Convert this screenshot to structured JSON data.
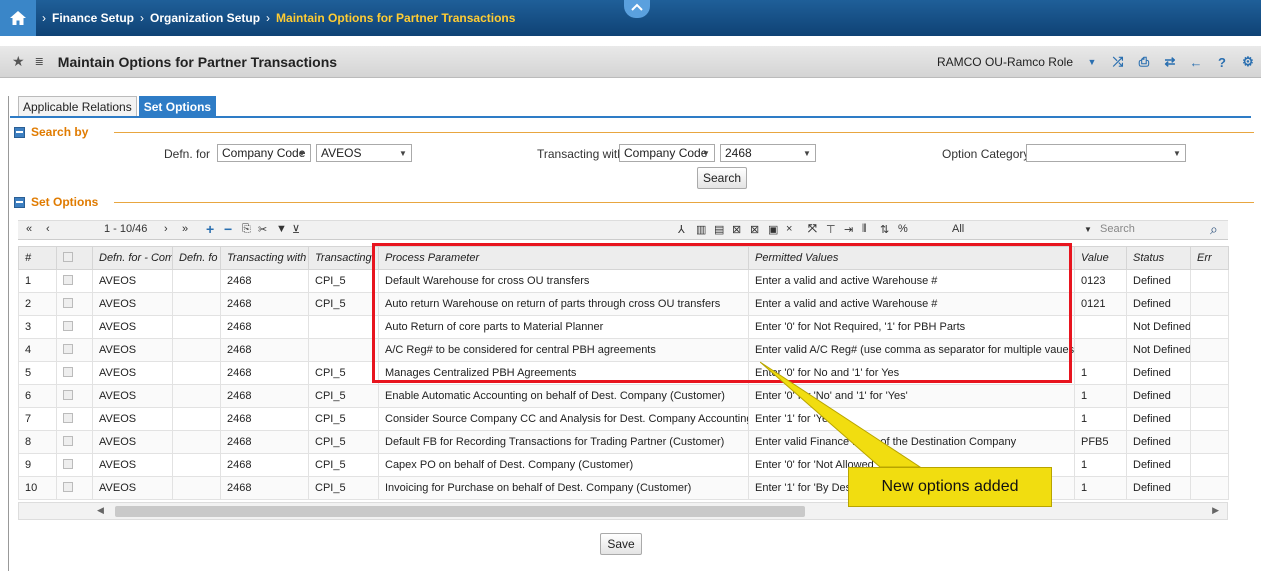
{
  "breadcrumb": {
    "items": [
      "Finance Setup",
      "Organization Setup"
    ],
    "current": "Maintain Options for Partner Transactions"
  },
  "title": "Maintain Options for Partner Transactions",
  "role": "RAMCO OU-Ramco Role",
  "tabs": [
    "Applicable Relations",
    "Set Options"
  ],
  "search_section": {
    "label": "Search by",
    "defn_for_label": "Defn. for",
    "defn_for_value": "Company Code",
    "company_value": "AVEOS",
    "transacting_label": "Transacting with",
    "transacting_value": "Company Code",
    "transacting_company": "2468",
    "option_category_label": "Option Category",
    "option_category_value": "",
    "search_button": "Search"
  },
  "options_section": {
    "label": "Set Options",
    "pager": "1 - 10/46",
    "filter_value": "All",
    "search_placeholder": "Search"
  },
  "table": {
    "columns": [
      "#",
      "",
      "Defn. for - Com",
      "Defn. fo",
      "Transacting with",
      "Transacting",
      "Process Parameter",
      "Permitted Values",
      "Value",
      "Status",
      "Err"
    ],
    "rows": [
      [
        "1",
        "",
        "AVEOS",
        "",
        "2468",
        "CPI_5",
        "Default Warehouse for cross OU transfers",
        "Enter a valid and active Warehouse #",
        "0123",
        "Defined",
        ""
      ],
      [
        "2",
        "",
        "AVEOS",
        "",
        "2468",
        "CPI_5",
        "Auto return Warehouse on return of parts through cross OU transfers",
        "Enter a valid and active Warehouse #",
        "0121",
        "Defined",
        ""
      ],
      [
        "3",
        "",
        "AVEOS",
        "",
        "2468",
        "",
        "Auto Return of core parts to Material Planner",
        "Enter '0' for Not Required, '1' for PBH Parts",
        "",
        "Not Defined",
        ""
      ],
      [
        "4",
        "",
        "AVEOS",
        "",
        "2468",
        "",
        "A/C Reg# to be considered for central PBH agreements",
        "Enter valid A/C Reg# (use comma as separator for multiple vaues)",
        "",
        "Not Defined",
        ""
      ],
      [
        "5",
        "",
        "AVEOS",
        "",
        "2468",
        "CPI_5",
        "Manages Centralized PBH Agreements",
        "Enter '0' for No and '1' for Yes",
        "1",
        "Defined",
        ""
      ],
      [
        "6",
        "",
        "AVEOS",
        "",
        "2468",
        "CPI_5",
        "Enable Automatic Accounting on behalf of Dest. Company (Customer)",
        "Enter '0' for 'No' and '1' for 'Yes'",
        "1",
        "Defined",
        ""
      ],
      [
        "7",
        "",
        "AVEOS",
        "",
        "2468",
        "CPI_5",
        "Consider Source Company CC and Analysis for Dest. Company Accounting",
        "Enter '1' for 'Yes'",
        "1",
        "Defined",
        ""
      ],
      [
        "8",
        "",
        "AVEOS",
        "",
        "2468",
        "CPI_5",
        "Default FB for Recording Transactions for Trading Partner (Customer)",
        "Enter valid Finance Book of the Destination Company",
        "PFB5",
        "Defined",
        ""
      ],
      [
        "9",
        "",
        "AVEOS",
        "",
        "2468",
        "CPI_5",
        "Capex PO on behalf of Dest. Company (Customer)",
        "Enter '0' for 'Not Allowed'",
        "1",
        "Defined",
        ""
      ],
      [
        "10",
        "",
        "AVEOS",
        "",
        "2468",
        "CPI_5",
        "Invoicing for Purchase on behalf of Dest. Company (Customer)",
        "Enter '1' for 'By Destination'",
        "1",
        "Defined",
        ""
      ]
    ]
  },
  "save_button": "Save",
  "callout": "New options added"
}
